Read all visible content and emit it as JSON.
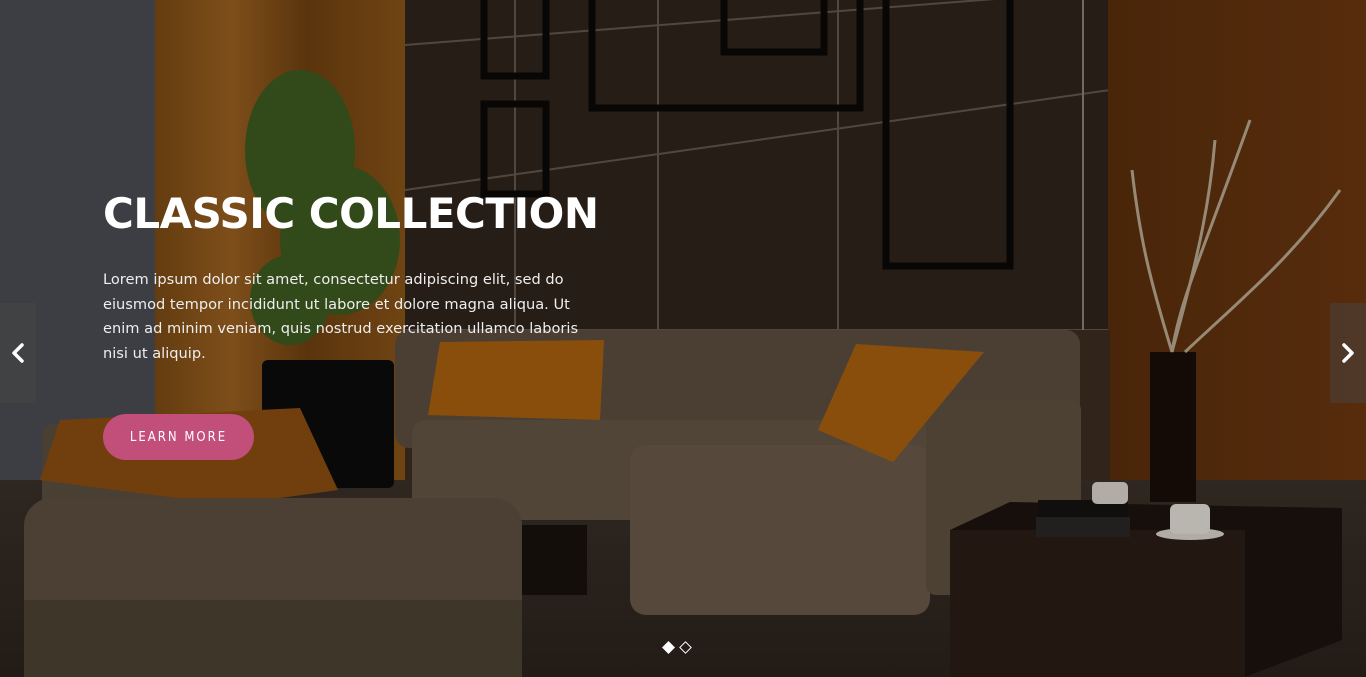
{
  "slider": {
    "title": "CLASSIC COLLECTION",
    "description": "Lorem ipsum dolor sit amet, consectetur adipiscing elit, sed do eiusmod tempor incididunt ut labore et dolore magna aliqua. Ut enim ad minim veniam, quis nostrud exercitation ullamco laboris nisi ut aliquip.",
    "button_label": "LEARN MORE",
    "prev_icon": "chevron-left-icon",
    "next_icon": "chevron-right-icon",
    "slides_count": 2,
    "active_slide": 1
  },
  "colors": {
    "accent": "#c24f79"
  }
}
